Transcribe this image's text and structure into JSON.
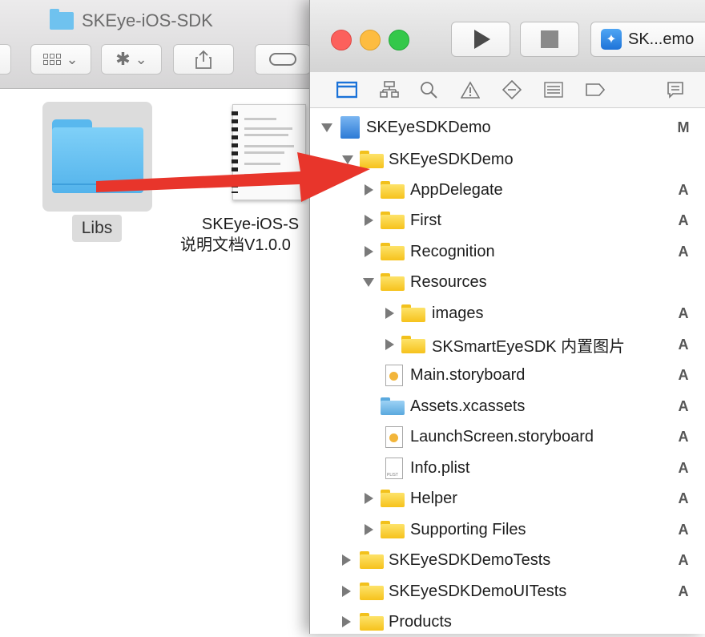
{
  "finder": {
    "title": "SKEye-iOS-SDK",
    "items": [
      {
        "label": "Libs"
      },
      {
        "label_line1": "SKEye-iOS-S",
        "label_line2": "说明文档V1.0.0"
      }
    ]
  },
  "xcode": {
    "scheme_label": "SK...emo",
    "tree": [
      {
        "label": "SKEyeSDKDemo",
        "status": "M"
      },
      {
        "label": "SKEyeSDKDemo",
        "status": ""
      },
      {
        "label": "AppDelegate",
        "status": "A"
      },
      {
        "label": "First",
        "status": "A"
      },
      {
        "label": "Recognition",
        "status": "A"
      },
      {
        "label": "Resources",
        "status": ""
      },
      {
        "label": "images",
        "status": "A"
      },
      {
        "label": "SKSmartEyeSDK 内置图片",
        "status": "A"
      },
      {
        "label": "Main.storyboard",
        "status": "A"
      },
      {
        "label": "Assets.xcassets",
        "status": "A"
      },
      {
        "label": "LaunchScreen.storyboard",
        "status": "A"
      },
      {
        "label": "Info.plist",
        "status": "A"
      },
      {
        "label": "Helper",
        "status": "A"
      },
      {
        "label": "Supporting Files",
        "status": "A"
      },
      {
        "label": "SKEyeSDKDemoTests",
        "status": "A"
      },
      {
        "label": "SKEyeSDKDemoUITests",
        "status": "A"
      },
      {
        "label": "Products",
        "status": ""
      }
    ]
  },
  "colors": {
    "arrow": "#e8352b",
    "folder_yellow": "#f6c21c",
    "folder_blue": "#53b3eb",
    "selected_nav": "#1a72d8"
  }
}
